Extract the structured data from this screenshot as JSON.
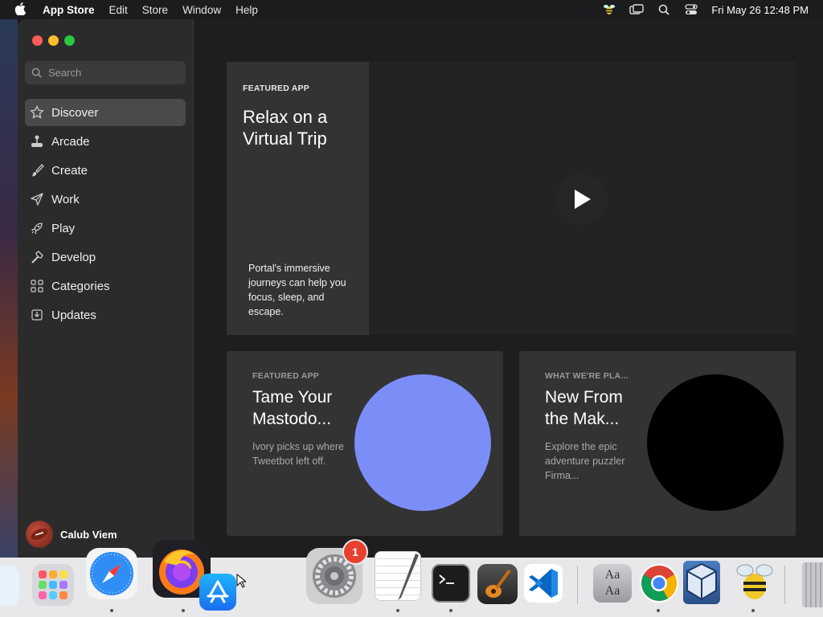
{
  "menubar": {
    "app_name": "App Store",
    "items": [
      "Edit",
      "Store",
      "Window",
      "Help"
    ],
    "clock": "Fri May 26  12:48 PM",
    "status_icons": [
      "bee-icon",
      "screen-mirroring-icon",
      "search-icon",
      "control-center-icon"
    ]
  },
  "sidebar": {
    "search_placeholder": "Search",
    "items": [
      {
        "label": "Discover",
        "icon": "star-icon",
        "selected": true
      },
      {
        "label": "Arcade",
        "icon": "joystick-icon"
      },
      {
        "label": "Create",
        "icon": "brush-icon"
      },
      {
        "label": "Work",
        "icon": "paper-plane-icon"
      },
      {
        "label": "Play",
        "icon": "rocket-icon"
      },
      {
        "label": "Develop",
        "icon": "hammer-icon"
      },
      {
        "label": "Categories",
        "icon": "grid-icon"
      },
      {
        "label": "Updates",
        "icon": "download-tray-icon"
      }
    ],
    "user_name": "Calub Viem"
  },
  "hero": {
    "eyebrow": "FEATURED APP",
    "title": "Relax on a Virtual Trip",
    "description": "Portal's immersive journeys can help you focus, sleep, and escape."
  },
  "cards": [
    {
      "eyebrow": "FEATURED APP",
      "title_line1": "Tame Your",
      "title_line2": "Mastodo...",
      "description": "Ivory picks up where Tweetbot left off.",
      "circle_color": "#7b8ef8"
    },
    {
      "eyebrow": "WHAT WE'RE PLA...",
      "title_line1": "New From",
      "title_line2": "the Mak...",
      "description": "Explore the epic adventure puzzler Firma...",
      "circle_color": "#000000"
    }
  ],
  "dock": {
    "items": [
      "finder-icon",
      "launchpad-icon",
      "safari-icon",
      "firefox-icon",
      "app-store-icon",
      "system-settings-icon",
      "textedit-icon",
      "terminal-icon",
      "garageband-icon",
      "vscode-icon",
      "dictionary-icon",
      "chrome-icon",
      "virtualbox-icon",
      "bee-app-icon",
      "trash-icon"
    ],
    "settings_badge": "1"
  },
  "colors": {
    "accent_close": "#fe5f57",
    "accent_min": "#febc2e",
    "accent_max": "#28c840"
  }
}
